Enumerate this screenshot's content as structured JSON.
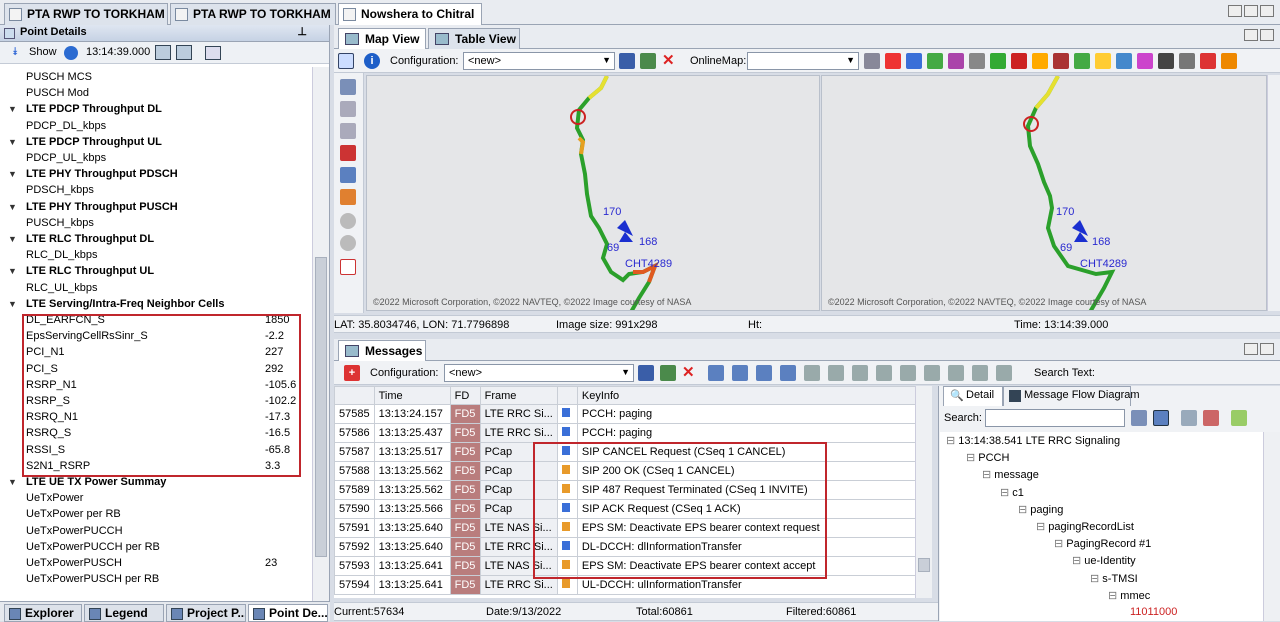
{
  "doc_tabs": [
    "PTA RWP TO TORKHAM",
    "PTA RWP TO TORKHAM",
    "Nowshera to Chitral"
  ],
  "left_panel": {
    "title": "Point Details",
    "show_label": "Show",
    "time": "13:14:39.000",
    "rows": [
      {
        "name": "PUSCH MCS",
        "value": "",
        "header": false
      },
      {
        "name": "PUSCH Mod",
        "value": "",
        "header": false
      },
      {
        "name": "LTE PDCP Throughput DL",
        "value": "",
        "header": true
      },
      {
        "name": "PDCP_DL_kbps",
        "value": "",
        "header": false
      },
      {
        "name": "LTE PDCP Throughput UL",
        "value": "",
        "header": true
      },
      {
        "name": "PDCP_UL_kbps",
        "value": "",
        "header": false
      },
      {
        "name": "LTE PHY Throughput PDSCH",
        "value": "",
        "header": true
      },
      {
        "name": "PDSCH_kbps",
        "value": "",
        "header": false
      },
      {
        "name": "LTE PHY Throughput PUSCH",
        "value": "",
        "header": true
      },
      {
        "name": "PUSCH_kbps",
        "value": "",
        "header": false
      },
      {
        "name": "LTE RLC Throughput DL",
        "value": "",
        "header": true
      },
      {
        "name": "RLC_DL_kbps",
        "value": "",
        "header": false
      },
      {
        "name": "LTE RLC Throughput UL",
        "value": "",
        "header": true
      },
      {
        "name": "RLC_UL_kbps",
        "value": "",
        "header": false
      },
      {
        "name": "LTE Serving/Intra-Freq Neighbor Cells",
        "value": "",
        "header": true
      },
      {
        "name": "DL_EARFCN_S",
        "value": "1850",
        "header": false
      },
      {
        "name": "EpsServingCellRsSinr_S",
        "value": "-2.2",
        "header": false
      },
      {
        "name": "PCI_N1",
        "value": "227",
        "header": false
      },
      {
        "name": "PCI_S",
        "value": "292",
        "header": false
      },
      {
        "name": "RSRP_N1",
        "value": "-105.6",
        "header": false
      },
      {
        "name": "RSRP_S",
        "value": "-102.2",
        "header": false
      },
      {
        "name": "RSRQ_N1",
        "value": "-17.3",
        "header": false
      },
      {
        "name": "RSRQ_S",
        "value": "-16.5",
        "header": false
      },
      {
        "name": "RSSI_S",
        "value": "-65.8",
        "header": false
      },
      {
        "name": "S2N1_RSRP",
        "value": "3.3",
        "header": false
      },
      {
        "name": "LTE UE TX Power Summay",
        "value": "",
        "header": true
      },
      {
        "name": "UeTxPower",
        "value": "",
        "header": false
      },
      {
        "name": "UeTxPower per RB",
        "value": "",
        "header": false
      },
      {
        "name": "UeTxPowerPUCCH",
        "value": "",
        "header": false
      },
      {
        "name": "UeTxPowerPUCCH per RB",
        "value": "",
        "header": false
      },
      {
        "name": "UeTxPowerPUSCH",
        "value": "23",
        "header": false
      },
      {
        "name": "UeTxPowerPUSCH per RB",
        "value": "",
        "header": false
      }
    ],
    "bottom_tabs": [
      "Explorer",
      "Legend",
      "Project P...",
      "Point De..."
    ]
  },
  "map_tabs": [
    "Map View",
    "Table View"
  ],
  "map_toolbar": {
    "config_label": "Configuration:",
    "config_value": "<new>",
    "online_label": "OnlineMap:",
    "online_value": ""
  },
  "map": {
    "copyright": "©2022 Microsoft Corporation, ©2022 NAVTEQ, ©2022 Image courtesy of NASA",
    "labels": [
      "170",
      "168",
      "69",
      "CHT4289"
    ]
  },
  "map_status": {
    "latlon": "LAT: 35.8034746, LON: 71.7796898",
    "image_size": "Image size: 991x298",
    "ht": "Ht:",
    "time": "Time: 13:14:39.000"
  },
  "messages": {
    "title": "Messages",
    "config_label": "Configuration:",
    "config_value": "<new>",
    "search_label": "Search Text:",
    "columns": [
      "Time",
      "FD",
      "Frame",
      "KeyInfo"
    ],
    "rows": [
      {
        "id": "57585",
        "time": "13:13:24.157",
        "fd": "FD5",
        "frame": "LTE RRC Si...",
        "dir": "d",
        "key": "PCCH: paging"
      },
      {
        "id": "57586",
        "time": "13:13:25.437",
        "fd": "FD5",
        "frame": "LTE RRC Si...",
        "dir": "d",
        "key": "PCCH: paging"
      },
      {
        "id": "57587",
        "time": "13:13:25.517",
        "fd": "FD5",
        "frame": "PCap",
        "dir": "d",
        "key": "SIP CANCEL Request (CSeq  1 CANCEL)"
      },
      {
        "id": "57588",
        "time": "13:13:25.562",
        "fd": "FD5",
        "frame": "PCap",
        "dir": "u",
        "key": "SIP 200 OK (CSeq  1 CANCEL)"
      },
      {
        "id": "57589",
        "time": "13:13:25.562",
        "fd": "FD5",
        "frame": "PCap",
        "dir": "u",
        "key": "SIP 487 Request Terminated (CSeq  1 INVITE)"
      },
      {
        "id": "57590",
        "time": "13:13:25.566",
        "fd": "FD5",
        "frame": "PCap",
        "dir": "d",
        "key": "SIP ACK Request (CSeq  1 ACK)"
      },
      {
        "id": "57591",
        "time": "13:13:25.640",
        "fd": "FD5",
        "frame": "LTE NAS Si...",
        "dir": "u",
        "key": "EPS SM: Deactivate EPS bearer context request"
      },
      {
        "id": "57592",
        "time": "13:13:25.640",
        "fd": "FD5",
        "frame": "LTE RRC Si...",
        "dir": "d",
        "key": "DL-DCCH: dlInformationTransfer"
      },
      {
        "id": "57593",
        "time": "13:13:25.641",
        "fd": "FD5",
        "frame": "LTE NAS Si...",
        "dir": "u",
        "key": "EPS SM: Deactivate EPS bearer context accept"
      },
      {
        "id": "57594",
        "time": "13:13:25.641",
        "fd": "FD5",
        "frame": "LTE RRC Si...",
        "dir": "u",
        "key": "UL-DCCH: ulInformationTransfer"
      }
    ],
    "status": {
      "current": "Current:57634",
      "date": "Date:9/13/2022",
      "total": "Total:60861",
      "filtered": "Filtered:60861"
    }
  },
  "detail": {
    "tabs": [
      "Detail",
      "Message Flow Diagram"
    ],
    "search_label": "Search:",
    "tree": [
      "13:14:38.541 LTE RRC Signaling",
      "PCCH",
      "message",
      "c1",
      "paging",
      "pagingRecordList",
      "PagingRecord #1",
      "ue-Identity",
      "s-TMSI",
      "mmec",
      "11011000"
    ]
  }
}
